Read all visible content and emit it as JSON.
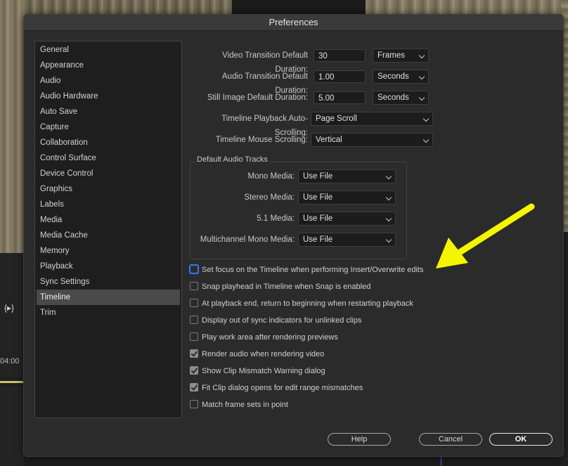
{
  "window": {
    "title": "Preferences"
  },
  "background": {
    "timecode": "04:00",
    "timeline_icon_text": "{▸}"
  },
  "sidebar": {
    "items": [
      {
        "label": "General"
      },
      {
        "label": "Appearance"
      },
      {
        "label": "Audio"
      },
      {
        "label": "Audio Hardware"
      },
      {
        "label": "Auto Save"
      },
      {
        "label": "Capture"
      },
      {
        "label": "Collaboration"
      },
      {
        "label": "Control Surface"
      },
      {
        "label": "Device Control"
      },
      {
        "label": "Graphics"
      },
      {
        "label": "Labels"
      },
      {
        "label": "Media"
      },
      {
        "label": "Media Cache"
      },
      {
        "label": "Memory"
      },
      {
        "label": "Playback"
      },
      {
        "label": "Sync Settings"
      },
      {
        "label": "Timeline"
      },
      {
        "label": "Trim"
      }
    ],
    "selected": "Timeline"
  },
  "settings": {
    "video_transition": {
      "label": "Video Transition Default Duration:",
      "value": "30",
      "unit": "Frames"
    },
    "audio_transition": {
      "label": "Audio Transition Default Duration:",
      "value": "1.00",
      "unit": "Seconds"
    },
    "still_image": {
      "label": "Still Image Default Duration:",
      "value": "5.00",
      "unit": "Seconds"
    },
    "auto_scrolling": {
      "label": "Timeline Playback Auto-Scrolling:",
      "value": "Page Scroll"
    },
    "mouse_scrolling": {
      "label": "Timeline Mouse Scrolling:",
      "value": "Vertical"
    }
  },
  "audio_tracks": {
    "title": "Default Audio Tracks",
    "mono": {
      "label": "Mono Media:",
      "value": "Use File"
    },
    "stereo": {
      "label": "Stereo Media:",
      "value": "Use File"
    },
    "surround": {
      "label": "5.1 Media:",
      "value": "Use File"
    },
    "multichannel": {
      "label": "Multichannel Mono Media:",
      "value": "Use File"
    }
  },
  "checkboxes": [
    {
      "label": "Set focus on the Timeline when performing Insert/Overwrite edits",
      "checked": false,
      "focused": true
    },
    {
      "label": "Snap playhead in Timeline when Snap is enabled",
      "checked": false
    },
    {
      "label": "At playback end, return to beginning when restarting playback",
      "checked": false
    },
    {
      "label": "Display out of sync indicators for unlinked clips",
      "checked": false
    },
    {
      "label": "Play work area after rendering previews",
      "checked": false
    },
    {
      "label": "Render audio when rendering video",
      "checked": true
    },
    {
      "label": "Show Clip Mismatch Warning dialog",
      "checked": true
    },
    {
      "label": "Fit Clip dialog opens for edit range mismatches",
      "checked": true
    },
    {
      "label": "Match frame sets in point",
      "checked": false
    }
  ],
  "buttons": {
    "help": "Help",
    "cancel": "Cancel",
    "ok": "OK"
  },
  "colors": {
    "annotation_arrow": "#f5f500",
    "focus_ring": "#2f7bf5"
  }
}
